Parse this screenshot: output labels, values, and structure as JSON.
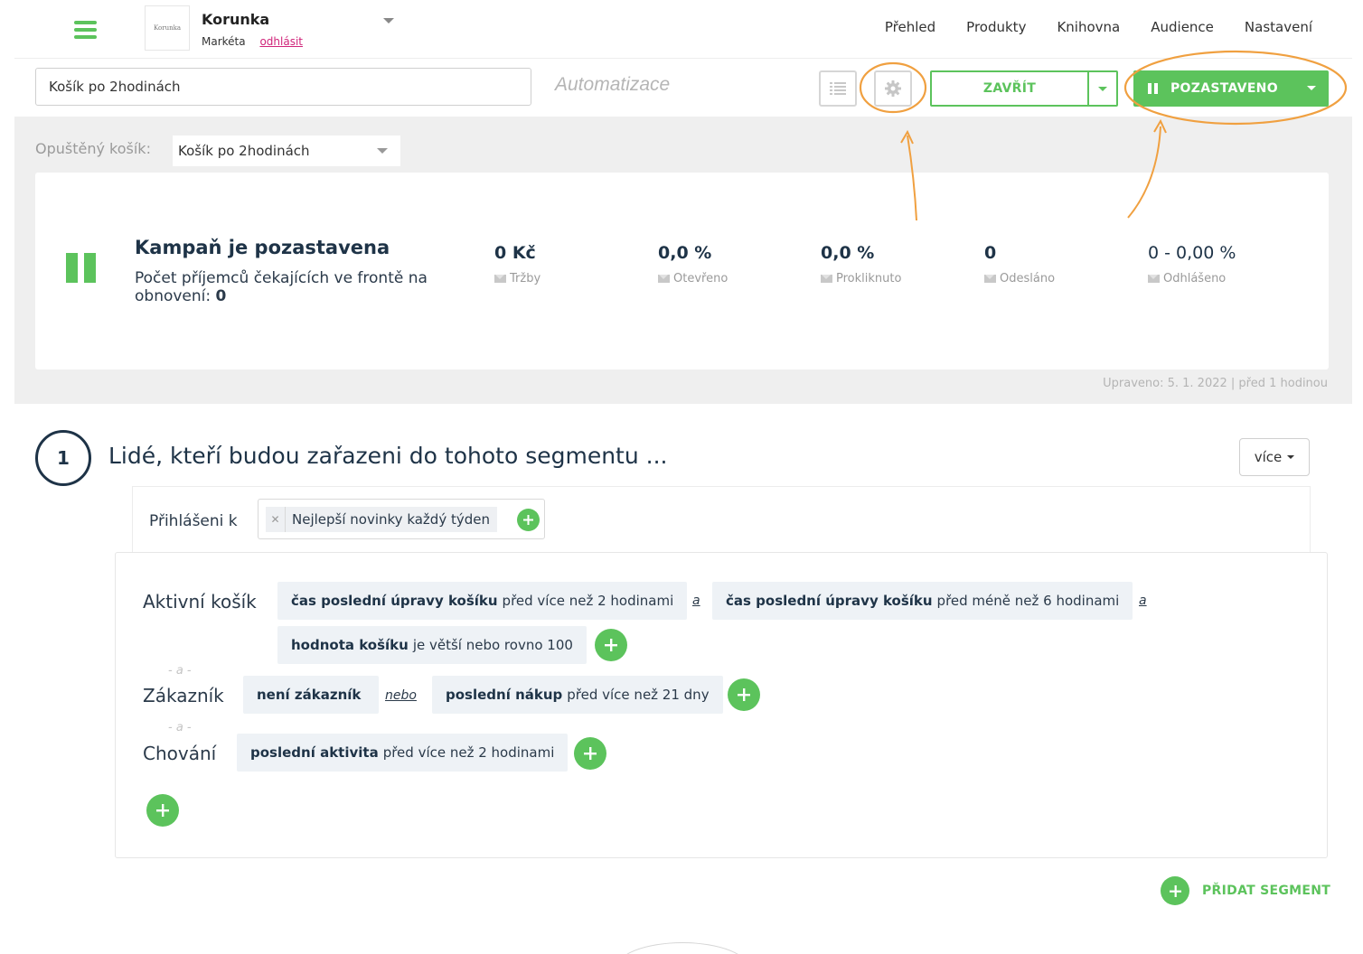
{
  "nav": {
    "logo_text": "Korunka",
    "brand": "Korunka",
    "user": "Markéta",
    "logout": "odhlásit",
    "menu": [
      "Přehled",
      "Produkty",
      "Knihovna",
      "Audience",
      "Nastavení"
    ]
  },
  "toolbar": {
    "name_value": "Košík po 2hodinách",
    "section_label": "Automatizace",
    "close_label": "ZAVŘÍT",
    "paused_label": "POZASTAVENO"
  },
  "campaign": {
    "cart_label": "Opuštěný košík:",
    "cart_value": "Košík po 2hodinách",
    "title": "Kampaň je pozastavena",
    "queue_text": "Počet příjemců čekajících ve frontě na obnovení:",
    "queue_value": "0",
    "stats": [
      {
        "value": "0 Kč",
        "label": "Tržby"
      },
      {
        "value": "0,0 %",
        "label": "Otevřeno"
      },
      {
        "value": "0,0 %",
        "label": "Prokliknuto"
      },
      {
        "value": "0",
        "label": "Odesláno"
      },
      {
        "value": "0 - 0,00 %",
        "label": "Odhlášeno"
      }
    ],
    "updated": "Upraveno: 5. 1. 2022 | před 1 hodinou"
  },
  "segment": {
    "number": "1",
    "title": "Lidé, kteří budou zařazeni do tohoto segmentu ...",
    "more_label": "více",
    "subscribed_label": "Přihlášeni k",
    "subscribed_tag": "Nejlepší novinky každý týden",
    "rows": {
      "cart": {
        "label": "Aktivní košík",
        "c1_bold": "čas poslední úpravy košíku",
        "c1_rest": "před více než 2 hodinami",
        "and1": "a",
        "c2_bold": "čas poslední úpravy košíku",
        "c2_rest": "před méně než 6 hodinami",
        "and2": "a",
        "c3_bold": "hodnota košíku",
        "c3_rest": "je větší nebo rovno 100"
      },
      "sep1": "- a -",
      "customer": {
        "label": "Zákazník",
        "c1_bold": "není zákazník",
        "or": "nebo",
        "c2_bold": "poslední nákup",
        "c2_rest": "před více než 21 dny"
      },
      "sep2": "- a -",
      "behavior": {
        "label": "Chování",
        "c1_bold": "poslední aktivita",
        "c1_rest": "před více než 2 hodinami"
      }
    },
    "add_segment": "PŘIDAT SEGMENT"
  },
  "colors": {
    "accent_green": "#5cc35c",
    "annotation_orange": "#f0a040",
    "logout_pink": "#d0247a"
  }
}
